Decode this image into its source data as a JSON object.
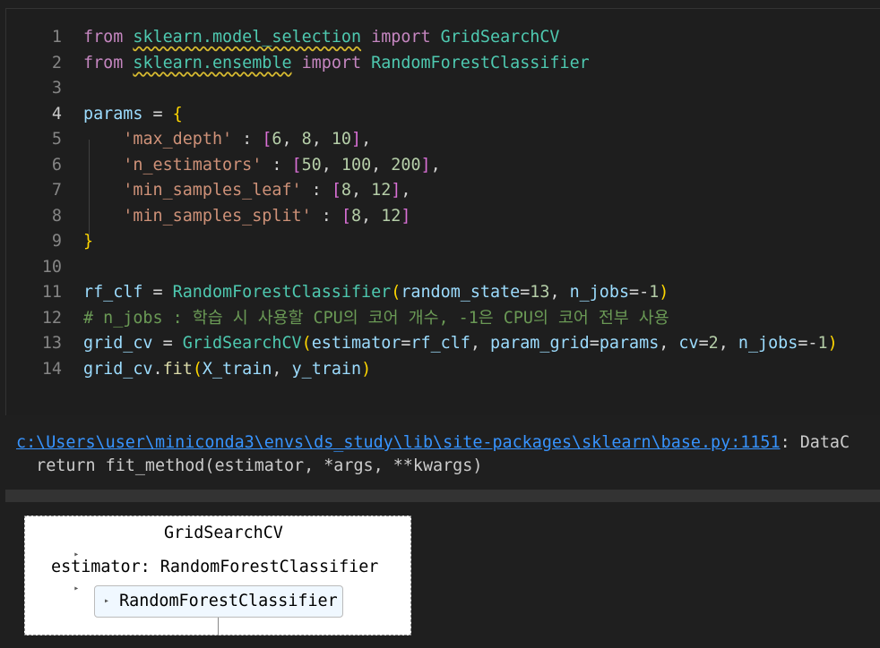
{
  "editor": {
    "lines": [
      {
        "no": "1",
        "parts": [
          [
            "kw",
            "from"
          ],
          [
            "op",
            " "
          ],
          [
            "mod",
            "sklearn.model_selection"
          ],
          [
            "op",
            " "
          ],
          [
            "kw",
            "import"
          ],
          [
            "op",
            " "
          ],
          [
            "cls",
            "GridSearchCV"
          ]
        ]
      },
      {
        "no": "2",
        "parts": [
          [
            "kw",
            "from"
          ],
          [
            "op",
            " "
          ],
          [
            "mod",
            "sklearn.ensemble"
          ],
          [
            "op",
            " "
          ],
          [
            "kw",
            "import"
          ],
          [
            "op",
            " "
          ],
          [
            "cls",
            "RandomForestClassifier"
          ]
        ]
      },
      {
        "no": "3",
        "parts": []
      },
      {
        "no": "4",
        "parts": [
          [
            "var",
            "params"
          ],
          [
            "op",
            " = "
          ],
          [
            "br1",
            "{"
          ]
        ]
      },
      {
        "no": "5",
        "parts": [
          [
            "op",
            "    "
          ],
          [
            "str",
            "'max_depth'"
          ],
          [
            "op",
            " : "
          ],
          [
            "br2",
            "["
          ],
          [
            "num",
            "6"
          ],
          [
            "op",
            ", "
          ],
          [
            "num",
            "8"
          ],
          [
            "op",
            ", "
          ],
          [
            "num",
            "10"
          ],
          [
            "br2",
            "]"
          ],
          [
            "op",
            ","
          ]
        ]
      },
      {
        "no": "6",
        "parts": [
          [
            "op",
            "    "
          ],
          [
            "str",
            "'n_estimators'"
          ],
          [
            "op",
            " : "
          ],
          [
            "br2",
            "["
          ],
          [
            "num",
            "50"
          ],
          [
            "op",
            ", "
          ],
          [
            "num",
            "100"
          ],
          [
            "op",
            ", "
          ],
          [
            "num",
            "200"
          ],
          [
            "br2",
            "]"
          ],
          [
            "op",
            ","
          ]
        ]
      },
      {
        "no": "7",
        "parts": [
          [
            "op",
            "    "
          ],
          [
            "str",
            "'min_samples_leaf'"
          ],
          [
            "op",
            " : "
          ],
          [
            "br2",
            "["
          ],
          [
            "num",
            "8"
          ],
          [
            "op",
            ", "
          ],
          [
            "num",
            "12"
          ],
          [
            "br2",
            "]"
          ],
          [
            "op",
            ","
          ]
        ]
      },
      {
        "no": "8",
        "parts": [
          [
            "op",
            "    "
          ],
          [
            "str",
            "'min_samples_split'"
          ],
          [
            "op",
            " : "
          ],
          [
            "br2",
            "["
          ],
          [
            "num",
            "8"
          ],
          [
            "op",
            ", "
          ],
          [
            "num",
            "12"
          ],
          [
            "br2",
            "]"
          ]
        ]
      },
      {
        "no": "9",
        "parts": [
          [
            "br1",
            "}"
          ]
        ]
      },
      {
        "no": "10",
        "parts": []
      },
      {
        "no": "11",
        "parts": [
          [
            "var",
            "rf_clf"
          ],
          [
            "op",
            " = "
          ],
          [
            "cls",
            "RandomForestClassifier"
          ],
          [
            "br1",
            "("
          ],
          [
            "var",
            "random_state"
          ],
          [
            "op",
            "="
          ],
          [
            "num",
            "13"
          ],
          [
            "op",
            ", "
          ],
          [
            "var",
            "n_jobs"
          ],
          [
            "op",
            "=-"
          ],
          [
            "num",
            "1"
          ],
          [
            "br1",
            ")"
          ]
        ]
      },
      {
        "no": "12",
        "parts": [
          [
            "cmt",
            "# n_jobs : 학습 시 사용할 CPU의 코어 개수, -1은 CPU의 코어 전부 사용"
          ]
        ]
      },
      {
        "no": "13",
        "parts": [
          [
            "var",
            "grid_cv"
          ],
          [
            "op",
            " = "
          ],
          [
            "cls",
            "GridSearchCV"
          ],
          [
            "br1",
            "("
          ],
          [
            "var",
            "estimator"
          ],
          [
            "op",
            "="
          ],
          [
            "var",
            "rf_clf"
          ],
          [
            "op",
            ", "
          ],
          [
            "var",
            "param_grid"
          ],
          [
            "op",
            "="
          ],
          [
            "var",
            "params"
          ],
          [
            "op",
            ", "
          ],
          [
            "var",
            "cv"
          ],
          [
            "op",
            "="
          ],
          [
            "num",
            "2"
          ],
          [
            "op",
            ", "
          ],
          [
            "var",
            "n_jobs"
          ],
          [
            "op",
            "=-"
          ],
          [
            "num",
            "1"
          ],
          [
            "br1",
            ")"
          ]
        ]
      },
      {
        "no": "14",
        "parts": [
          [
            "var",
            "grid_cv"
          ],
          [
            "op",
            "."
          ],
          [
            "fn",
            "fit"
          ],
          [
            "br1",
            "("
          ],
          [
            "var",
            "X_train"
          ],
          [
            "op",
            ", "
          ],
          [
            "var",
            "y_train"
          ],
          [
            "br1",
            ")"
          ]
        ]
      }
    ]
  },
  "output": {
    "link_text": "c:\\Users\\user\\miniconda3\\envs\\ds_study\\lib\\site-packages\\sklearn\\base.py:1151",
    "link_suffix": ": DataC",
    "line2": "  return fit_method(estimator, *args, **kwargs)"
  },
  "widget": {
    "title": "GridSearchCV",
    "estimator_row": "estimator: RandomForestClassifier",
    "inner_box": "RandomForestClassifier",
    "toggle_glyph": "▸"
  },
  "colors": {
    "keyword": "#c586c0",
    "class": "#4ec9b0",
    "variable": "#9cdcfe",
    "string": "#ce9178",
    "number": "#b5cea8",
    "comment": "#6a9955",
    "link": "#3794ff"
  }
}
